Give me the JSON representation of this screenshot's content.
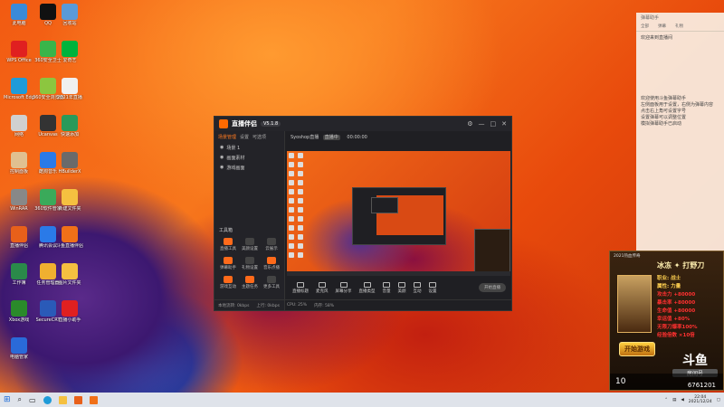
{
  "desktop_icons": [
    {
      "label": "此电脑",
      "icon": "computer-icon",
      "color": "#3a8ad8"
    },
    {
      "label": "QQ",
      "icon": "penguin-icon",
      "color": "#111111"
    },
    {
      "label": "回收站",
      "icon": "recycle-bin-icon",
      "color": "#5a9ad8"
    },
    {
      "label": "WPS Office",
      "icon": "wps-icon",
      "color": "#e02020"
    },
    {
      "label": "360安全卫士",
      "icon": "360-security-icon",
      "color": "#39b54a"
    },
    {
      "label": "爱奇艺",
      "icon": "iqiyi-icon",
      "color": "#00b33c"
    },
    {
      "label": "Microsoft Edge",
      "icon": "edge-icon",
      "color": "#1f9bd8"
    },
    {
      "label": "360安全浏览器",
      "icon": "360-browser-icon",
      "color": "#8cc63f"
    },
    {
      "label": "2021年直播",
      "icon": "document-icon",
      "color": "#f0f0f0"
    },
    {
      "label": "网络",
      "icon": "network-icon",
      "color": "#d0d0d0"
    },
    {
      "label": "Ucanvas",
      "icon": "ucanvas-icon",
      "color": "#333333"
    },
    {
      "label": "快速添加",
      "icon": "add-icon",
      "color": "#2a9a5a"
    },
    {
      "label": "控制面板",
      "icon": "control-panel-icon",
      "color": "#e0c090"
    },
    {
      "label": "酷狗音乐",
      "icon": "kugou-icon",
      "color": "#2a7ae8"
    },
    {
      "label": "HBuilderX",
      "icon": "app-icon",
      "color": "#6a6a6a"
    },
    {
      "label": "WinRAR",
      "icon": "winrar-icon",
      "color": "#888888"
    },
    {
      "label": "360软件管家",
      "icon": "app-icon",
      "color": "#3aaa5a"
    },
    {
      "label": "新建文件夹",
      "icon": "folder-icon",
      "color": "#f5c040"
    },
    {
      "label": "直播伴侣",
      "icon": "live-icon",
      "color": "#e8601a"
    },
    {
      "label": "腾讯会议",
      "icon": "app-icon",
      "color": "#2a7ae8"
    },
    {
      "label": "斗鱼直播伴侣",
      "icon": "douyu-icon",
      "color": "#f07018"
    },
    {
      "label": "工作簿",
      "icon": "excel-icon",
      "color": "#2a8a4a"
    },
    {
      "label": "任务管理器",
      "icon": "app-icon",
      "color": "#f0b030"
    },
    {
      "label": "图片文件夹",
      "icon": "folder-icon",
      "color": "#f5c040"
    },
    {
      "label": "Xbox游戏",
      "icon": "xbox-icon",
      "color": "#2a8a2a"
    },
    {
      "label": "SecureCRT",
      "icon": "app-icon",
      "color": "#2a5ab8"
    },
    {
      "label": "直播小助手",
      "icon": "app-icon",
      "color": "#e02020"
    },
    {
      "label": "电脑管家",
      "icon": "app-icon",
      "color": "#2a6ad8"
    }
  ],
  "app": {
    "name": "直播伴侣",
    "version": "V5.1.8",
    "left_tabs": [
      "场景管理",
      "设置",
      "可选项"
    ],
    "scenes": [
      "场景 1",
      "画面素材",
      "游戏画面"
    ],
    "tools_title": "工具箱",
    "tools": [
      "直播工具",
      "美颜设置",
      "云展示",
      "弹幕助手",
      "礼物设置",
      "音乐点播",
      "游戏互动",
      "主题任务",
      "更多工具"
    ],
    "stage_header": [
      "Syoshop直播",
      "直播中",
      "00:00:00"
    ],
    "bottom_controls": [
      "直播标题",
      "麦克风",
      "屏幕分享",
      "直播类型",
      "音量",
      "美颜",
      "互动",
      "设置"
    ],
    "start_label": "开始直播",
    "status": [
      "本地流转: 0kbps",
      "上行: 0kbps",
      "CPU: 25%",
      "内存: 58%"
    ]
  },
  "danmu": {
    "header": "弹幕助手",
    "tabs": [
      "全部",
      "弹幕",
      "礼物"
    ],
    "lines": [
      "欢迎来到直播间",
      "欢迎使用斗鱼弹幕助手",
      "左侧面板用于设置，右侧为弹幕内容",
      "点击右上角可设置字号",
      "设置弹幕可以调整位置",
      "模拟弹幕助手已启动"
    ]
  },
  "ad": {
    "top": "2021热血传奇",
    "title": "冰冻 ✦ 打野刀",
    "list": [
      "职业: 战士",
      "属性: 力量",
      "攻击力 +80000",
      "暴击率 +80000",
      "生命值 +80000",
      "幸运值 +80%",
      "无限刀爆率100%",
      "经验倍数 ×10倍"
    ],
    "button": "开始游戏",
    "logo": "斗鱼",
    "room_label": "房间号",
    "num_left": "10",
    "room_id": "6761201"
  },
  "taskbar": {
    "time": "22:04",
    "date": "2021/12/24"
  }
}
